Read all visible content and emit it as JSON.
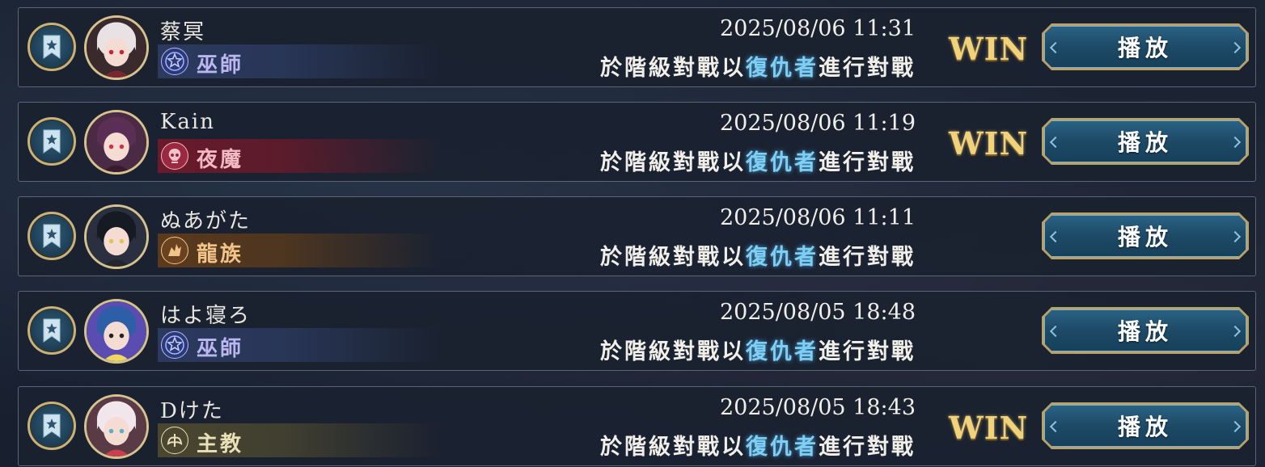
{
  "colors": {
    "win": "#efd27a",
    "highlight": "#7fcff2",
    "play_button": "#1d4a66",
    "frame_gold": "#c8b27a"
  },
  "matches": [
    {
      "player_name": "蔡冥",
      "class_name": "巫師",
      "class_icon": "runecraft-star-icon",
      "class_color": "#b9b6f0",
      "class_bar": "#2c3a60",
      "avatar": "player-avatar-red-eyed-girl",
      "datetime": "2025/08/06 11:31",
      "desc_prefix": "於階級對戰以",
      "desc_highlight": "復仇者",
      "desc_suffix": "進行對戰",
      "result": "WIN",
      "play_label": "播放"
    },
    {
      "player_name": "Kain",
      "class_name": "夜魔",
      "class_icon": "bloodcraft-skull-icon",
      "class_color": "#f3b9c2",
      "class_bar": "#6a1a2a",
      "avatar": "player-avatar-vampire-girl",
      "datetime": "2025/08/06 11:19",
      "desc_prefix": "於階級對戰以",
      "desc_highlight": "復仇者",
      "desc_suffix": "進行對戰",
      "result": "WIN",
      "play_label": "播放"
    },
    {
      "player_name": "ぬあがた",
      "class_name": "龍族",
      "class_icon": "dragoncraft-dragon-icon",
      "class_color": "#f2c48a",
      "class_bar": "#5a3a1c",
      "avatar": "player-avatar-dark-haired-boy",
      "datetime": "2025/08/06 11:11",
      "desc_prefix": "於階級對戰以",
      "desc_highlight": "復仇者",
      "desc_suffix": "進行對戰",
      "result": "",
      "play_label": "播放"
    },
    {
      "player_name": "はよ寝ろ",
      "class_name": "巫師",
      "class_icon": "runecraft-star-icon",
      "class_color": "#b9b6f0",
      "class_bar": "#2c3a60",
      "avatar": "player-avatar-penguin-mascot",
      "datetime": "2025/08/05 18:48",
      "desc_prefix": "於階級對戰以",
      "desc_highlight": "復仇者",
      "desc_suffix": "進行對戰",
      "result": "",
      "play_label": "播放"
    },
    {
      "player_name": "Dけた",
      "class_name": "主教",
      "class_icon": "havencraft-wings-icon",
      "class_color": "#e9e0b8",
      "class_bar": "#4a4630",
      "avatar": "player-avatar-white-haired-girl",
      "datetime": "2025/08/05 18:43",
      "desc_prefix": "於階級對戰以",
      "desc_highlight": "復仇者",
      "desc_suffix": "進行對戰",
      "result": "WIN",
      "play_label": "播放"
    }
  ]
}
